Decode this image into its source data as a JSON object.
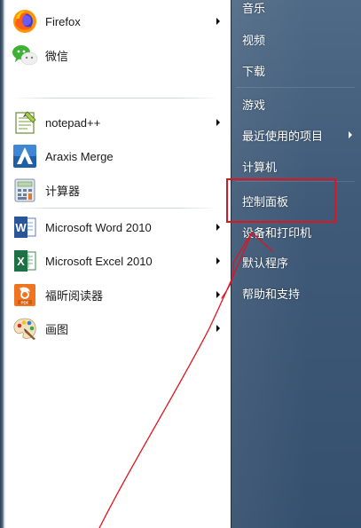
{
  "programs": [
    {
      "label": "Firefox",
      "icon": "firefox-icon",
      "has_submenu": true
    },
    {
      "label": "微信",
      "icon": "wechat-icon",
      "has_submenu": false
    },
    {
      "label": "notepad++",
      "icon": "notepad-plus-plus-icon",
      "has_submenu": true
    },
    {
      "label": "Araxis Merge",
      "icon": "araxis-merge-icon",
      "has_submenu": false
    },
    {
      "label": "计算器",
      "icon": "calculator-icon",
      "has_submenu": false
    },
    {
      "label": "Microsoft Word 2010",
      "icon": "word-icon",
      "has_submenu": true
    },
    {
      "label": "Microsoft Excel 2010",
      "icon": "excel-icon",
      "has_submenu": true
    },
    {
      "label": "福昕阅读器",
      "icon": "foxit-reader-icon",
      "has_submenu": true
    },
    {
      "label": "画图",
      "icon": "paint-icon",
      "has_submenu": true
    }
  ],
  "places": [
    {
      "label": "音乐",
      "has_submenu": false
    },
    {
      "label": "视频",
      "has_submenu": false
    },
    {
      "label": "下载",
      "has_submenu": false
    },
    {
      "label": "游戏",
      "has_submenu": false
    },
    {
      "label": "最近使用的项目",
      "has_submenu": true
    },
    {
      "label": "计算机",
      "has_submenu": false
    },
    {
      "label": "控制面板",
      "has_submenu": false
    },
    {
      "label": "设备和打印机",
      "has_submenu": false
    },
    {
      "label": "默认程序",
      "has_submenu": false
    },
    {
      "label": "帮助和支持",
      "has_submenu": false
    }
  ],
  "colors": {
    "annotation_red": "#e0141e",
    "places_background": "#3f5a78",
    "places_text": "#ffffff"
  }
}
